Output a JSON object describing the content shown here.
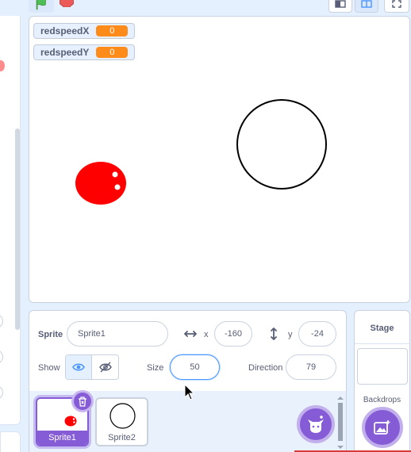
{
  "monitors": [
    {
      "label": "redspeedX",
      "value": "0"
    },
    {
      "label": "redspeedY",
      "value": "0"
    }
  ],
  "sprite_info": {
    "sprite_label": "Sprite",
    "sprite_name": "Sprite1",
    "x_label": "x",
    "x_value": "-160",
    "y_label": "y",
    "y_value": "-24",
    "show_label": "Show",
    "size_label": "Size",
    "size_value": "50",
    "direction_label": "Direction",
    "direction_value": "79"
  },
  "sprites": [
    {
      "name": "Sprite1",
      "selected": true
    },
    {
      "name": "Sprite2",
      "selected": false
    }
  ],
  "stage_panel": {
    "title": "Stage",
    "backdrops_label": "Backdrops"
  },
  "icons": {
    "green_flag": "green-flag-icon",
    "stop": "stop-icon",
    "small_stage": "small-stage-icon",
    "large_stage": "large-stage-icon",
    "fullscreen": "fullscreen-icon",
    "show_visible": "eye-icon",
    "show_hidden": "eye-slash-icon",
    "delete": "trash-icon",
    "choose_sprite": "cat-add-icon",
    "choose_backdrop": "image-add-icon"
  },
  "colors": {
    "accent": "#855cd6",
    "monitor_value": "#ff8c1a",
    "red_sprite": "#ff0000",
    "selection_blue": "#4c97ff"
  }
}
